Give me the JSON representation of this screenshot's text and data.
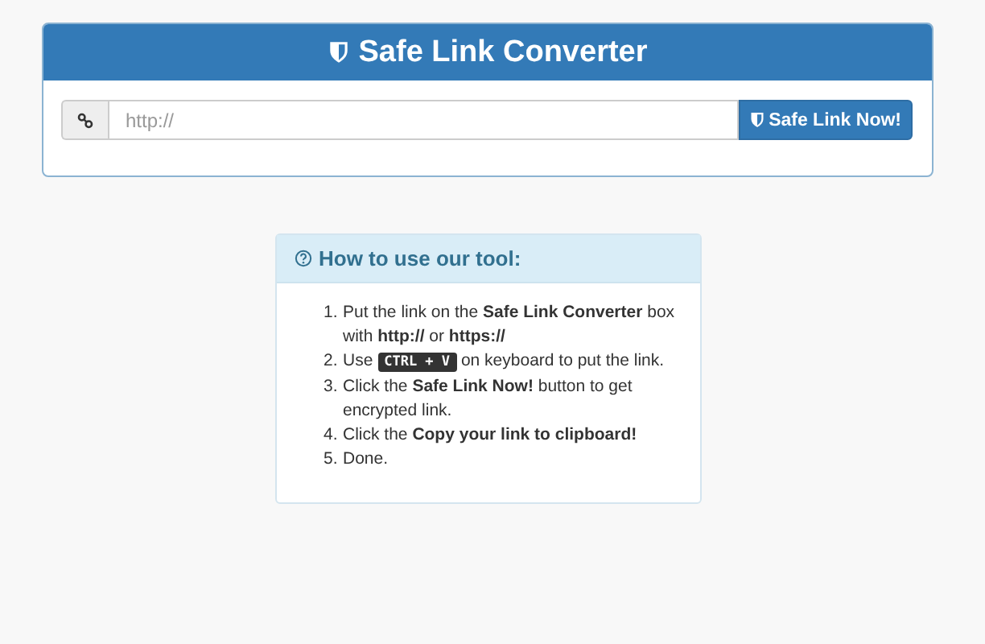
{
  "converter": {
    "title": "Safe Link Converter",
    "input": {
      "placeholder": "http://"
    },
    "button": "Safe Link Now!"
  },
  "help": {
    "title": "How to use our tool:",
    "steps": [
      {
        "number": "1.",
        "text": "Put the link on the **Safe Link Converter** box with **http://** or **https://**"
      },
      {
        "number": "2.",
        "before": "Use",
        "key": "CTRL + V",
        "after": "on keyboard to put the link."
      },
      {
        "number": "3.",
        "text": "Click the **Safe Link Now!** button to get encrypted link."
      },
      {
        "number": "4.",
        "text": "Click the **Copy your link to clipboard!**"
      },
      {
        "number": "5.",
        "text": "Done."
      }
    ]
  }
}
